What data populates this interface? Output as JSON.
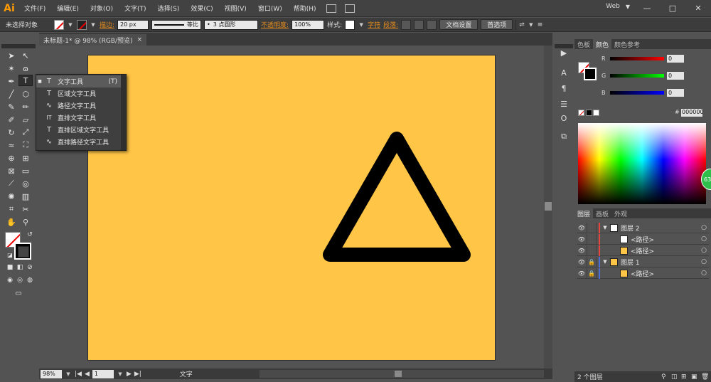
{
  "app": {
    "logo": "Ai",
    "workspace": "Web"
  },
  "menu": [
    "文件(F)",
    "编辑(E)",
    "对象(O)",
    "文字(T)",
    "选择(S)",
    "效果(C)",
    "视图(V)",
    "窗口(W)",
    "帮助(H)"
  ],
  "window_controls": {
    "minimize": "—",
    "maximize": "□",
    "close": "✕"
  },
  "control": {
    "selection": "未选择对象",
    "stroke_label": "描边:",
    "stroke_width": "20 px",
    "stroke_profile": "等比",
    "brush": "3 点圆形",
    "opacity_label": "不透明度:",
    "opacity": "100%",
    "style_label": "样式:",
    "char_label": "字符",
    "para_label": "段落:",
    "doc_setup": "文档设置",
    "prefs": "首选项"
  },
  "doc_tab": {
    "title": "未标题-1* @ 98% (RGB/预览)",
    "close": "×"
  },
  "flyout": [
    {
      "icon": "T",
      "label": "文字工具",
      "shortcut": "(T)"
    },
    {
      "icon": "T",
      "label": "区域文字工具",
      "shortcut": ""
    },
    {
      "icon": "∿",
      "label": "路径文字工具",
      "shortcut": ""
    },
    {
      "icon": "IT",
      "label": "直排文字工具",
      "shortcut": ""
    },
    {
      "icon": "T",
      "label": "直排区域文字工具",
      "shortcut": ""
    },
    {
      "icon": "∿",
      "label": "直排路径文字工具",
      "shortcut": ""
    }
  ],
  "status": {
    "zoom": "98%",
    "page": "1",
    "tool": "文字"
  },
  "color_panel": {
    "tabs": [
      "色板",
      "颜色",
      "颜色参考"
    ],
    "channels": [
      {
        "name": "R",
        "value": "0",
        "color": "#ff0000"
      },
      {
        "name": "G",
        "value": "0",
        "color": "#00ff00"
      },
      {
        "name": "B",
        "value": "0",
        "color": "#0000ff"
      }
    ],
    "hash": "#",
    "hex": "000000"
  },
  "layers_panel": {
    "tabs": [
      "图层",
      "画板",
      "外观"
    ],
    "rows": [
      {
        "name": "图层 2",
        "locked": false,
        "expand": "▼",
        "bar": "#e8453c",
        "thumb": "#ffffff",
        "indent": 0
      },
      {
        "name": "<路径>",
        "locked": false,
        "expand": "",
        "bar": "#e8453c",
        "thumb": "#ffffff",
        "indent": 1
      },
      {
        "name": "<路径>",
        "locked": false,
        "expand": "",
        "bar": "#e8453c",
        "thumb": "#ffc546",
        "indent": 1
      },
      {
        "name": "图层 1",
        "locked": true,
        "expand": "▼",
        "bar": "#4a6fd8",
        "thumb": "#ffc546",
        "indent": 0
      },
      {
        "name": "<路径>",
        "locked": true,
        "expand": "",
        "bar": "#4a6fd8",
        "thumb": "#ffc546",
        "indent": 1
      }
    ],
    "footer": "2 个图层"
  },
  "badge": "63",
  "colors": {
    "artboard": "#ffc546",
    "shape_stroke": "#000000",
    "accent": "#ff9a00"
  }
}
